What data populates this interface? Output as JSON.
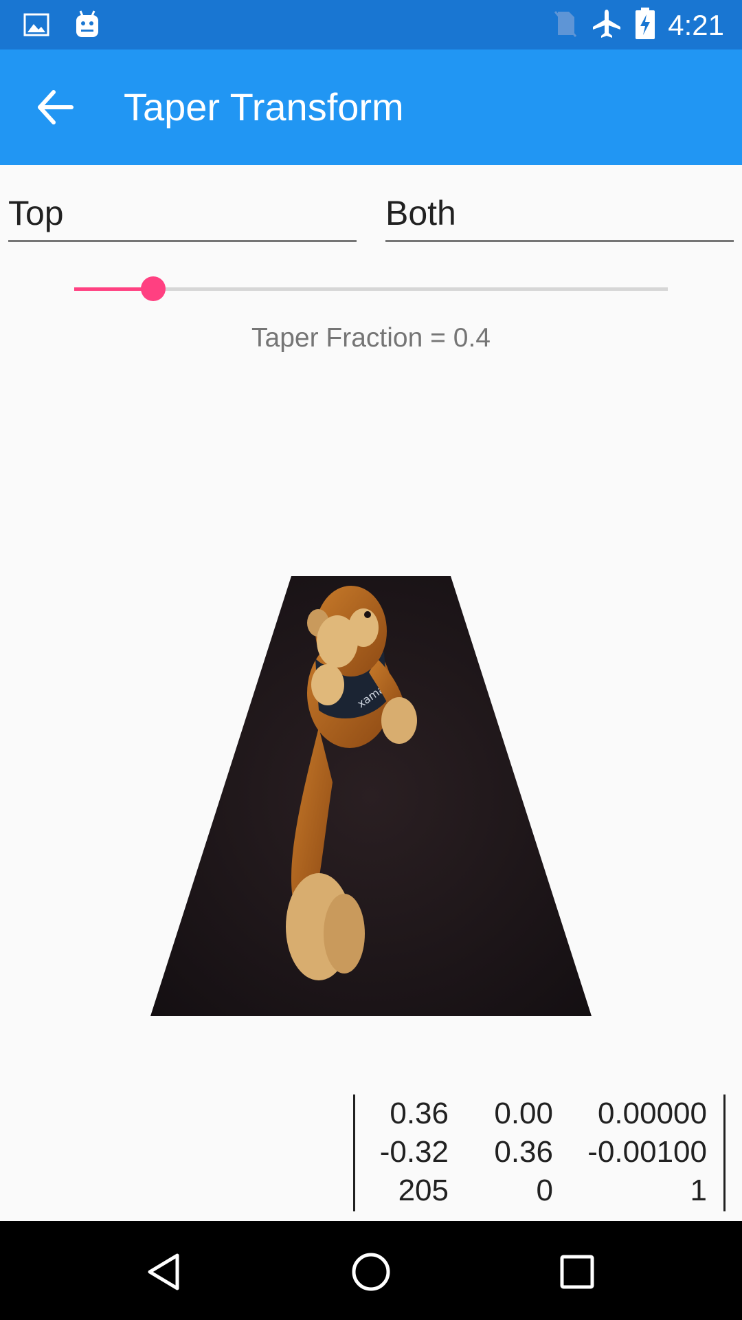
{
  "status_bar": {
    "time": "4:21",
    "icons": [
      "image-icon",
      "android-icon",
      "no-sim-icon",
      "airplane-mode-icon",
      "battery-charging-icon"
    ]
  },
  "app_bar": {
    "title": "Taper Transform",
    "back_icon": "arrow-back-icon"
  },
  "pickers": {
    "taper_side": "Top",
    "taper_corners": "Both"
  },
  "slider": {
    "value": 0.4,
    "min": 0,
    "max": 3,
    "caption": "Taper Fraction = 0.4"
  },
  "matrix": {
    "rows": [
      [
        "0.36",
        "0.00",
        "0.00000"
      ],
      [
        "-0.32",
        "0.36",
        "-0.00100"
      ],
      [
        "205",
        "0",
        "1"
      ]
    ]
  },
  "nav_bar": {
    "icons": [
      "back-triangle-icon",
      "home-circle-icon",
      "recents-square-icon"
    ]
  },
  "colors": {
    "status_bar": "#1976d2",
    "app_bar": "#2196f3",
    "accent": "#ff4081"
  }
}
